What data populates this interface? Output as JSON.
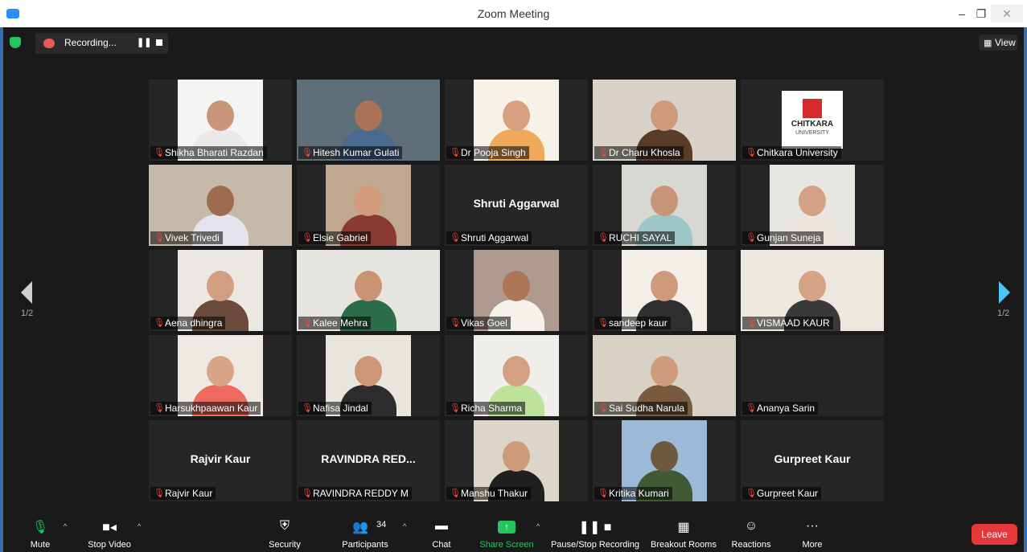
{
  "window": {
    "title": "Zoom Meeting",
    "min": "–",
    "max": "❐",
    "close": "✕"
  },
  "recording": {
    "label": "Recording...",
    "pause": "❚❚"
  },
  "view": {
    "label": "View",
    "icon": "▦"
  },
  "pagination": {
    "left": "1/2",
    "right": "1/2"
  },
  "participants": [
    {
      "name": "Shikha Bharati Razdan",
      "type": "video",
      "bg": "#f4f4f2",
      "skin": "#c9967a",
      "shirt": "#e9e9e9"
    },
    {
      "name": "Hitesh Kumar Gulati",
      "type": "video",
      "bg": "#5f6f7a",
      "skin": "#a87357",
      "shirt": "#4a6a90",
      "active": true
    },
    {
      "name": "Dr Pooja Singh",
      "type": "video",
      "bg": "#f6f2e8",
      "skin": "#d9a07f",
      "shirt": "#f0a85a"
    },
    {
      "name": "Dr Charu Khosla",
      "type": "video",
      "bg": "#d8d2c8",
      "skin": "#cf9a7c",
      "shirt": "#5a3c2a"
    },
    {
      "name": "Chitkara University",
      "type": "logo",
      "logo_text": "CHITKARA",
      "logo_sub": "UNIVERSITY"
    },
    {
      "name": "Vivek Trivedi",
      "type": "video",
      "bg": "#c7b9a9",
      "skin": "#9e6b50",
      "shirt": "#e4e4ec"
    },
    {
      "name": "Elsie Gabriel",
      "type": "video",
      "bg": "#c0a890",
      "skin": "#d49c7c",
      "shirt": "#8a3a30"
    },
    {
      "name": "Shruti Aggarwal",
      "type": "name",
      "display": "Shruti Aggarwal"
    },
    {
      "name": "RUCHI SAYAL",
      "type": "video",
      "bg": "#d8d8d2",
      "skin": "#c99578",
      "shirt": "#9ec6c6"
    },
    {
      "name": "Gunjan Suneja",
      "type": "video",
      "bg": "#e8e6e0",
      "skin": "#d3a286",
      "shirt": "#ece4de"
    },
    {
      "name": "Aena dhingra",
      "type": "video",
      "bg": "#ebe7e2",
      "skin": "#d39f83",
      "shirt": "#6a4a3a"
    },
    {
      "name": "Kalee Mehra",
      "type": "video",
      "bg": "#e6e4de",
      "skin": "#cb9273",
      "shirt": "#2e6d4c"
    },
    {
      "name": "Vikas Goel",
      "type": "video",
      "bg": "#b09a90",
      "skin": "#ad7659",
      "shirt": "#f5f2ec"
    },
    {
      "name": "sandeep kaur",
      "type": "video",
      "bg": "#f2efe8",
      "skin": "#cf9a7b",
      "shirt": "#2f2f2f"
    },
    {
      "name": "VISMAAD KAUR",
      "type": "video",
      "bg": "#ece8e0",
      "skin": "#d5a386",
      "shirt": "#3a3a3a"
    },
    {
      "name": "Harsukhpaawan Kaur",
      "type": "video",
      "bg": "#efe9e4",
      "skin": "#d8a486",
      "shirt": "#ef6a5e"
    },
    {
      "name": "Nafisa Jindal",
      "type": "video",
      "bg": "#e8e5dc",
      "skin": "#cc9677",
      "shirt": "#2c2c2c"
    },
    {
      "name": "Richa Sharma",
      "type": "video",
      "bg": "#f0eeea",
      "skin": "#d4a081",
      "shirt": "#bde39b"
    },
    {
      "name": "Sai Sudha Narula",
      "type": "video",
      "bg": "#d8d2c4",
      "skin": "#cf9b7d",
      "shirt": "#7a5a3e"
    },
    {
      "name": "Ananya Sarin",
      "type": "empty"
    },
    {
      "name": "Rajvir Kaur",
      "type": "name",
      "display": "Rajvir Kaur"
    },
    {
      "name": "RAVINDRA REDDY M",
      "type": "name",
      "display": "RAVINDRA RED..."
    },
    {
      "name": "Manshu Thakur",
      "type": "video",
      "bg": "#dcd6c8",
      "skin": "#cd9a7b",
      "shirt": "#1f1f1f"
    },
    {
      "name": "Kritika Kumari",
      "type": "video",
      "bg": "#9cbad8",
      "skin": "#6f5a40",
      "shirt": "#405a36"
    },
    {
      "name": "Gurpreet Kaur",
      "type": "name",
      "display": "Gurpreet Kaur"
    }
  ],
  "toolbar": {
    "mute": "Mute",
    "stop_video": "Stop Video",
    "security": "Security",
    "participants": "Participants",
    "participants_count": "34",
    "chat": "Chat",
    "share_screen": "Share Screen",
    "pause_stop_recording": "Pause/Stop Recording",
    "breakout_rooms": "Breakout Rooms",
    "reactions": "Reactions",
    "more": "More",
    "leave": "Leave"
  },
  "colors": {
    "accent": "#2d8cff",
    "active_speaker": "#e7e28a",
    "leave": "#e5383b",
    "share": "#23c55e",
    "muted": "#e74c3c"
  }
}
